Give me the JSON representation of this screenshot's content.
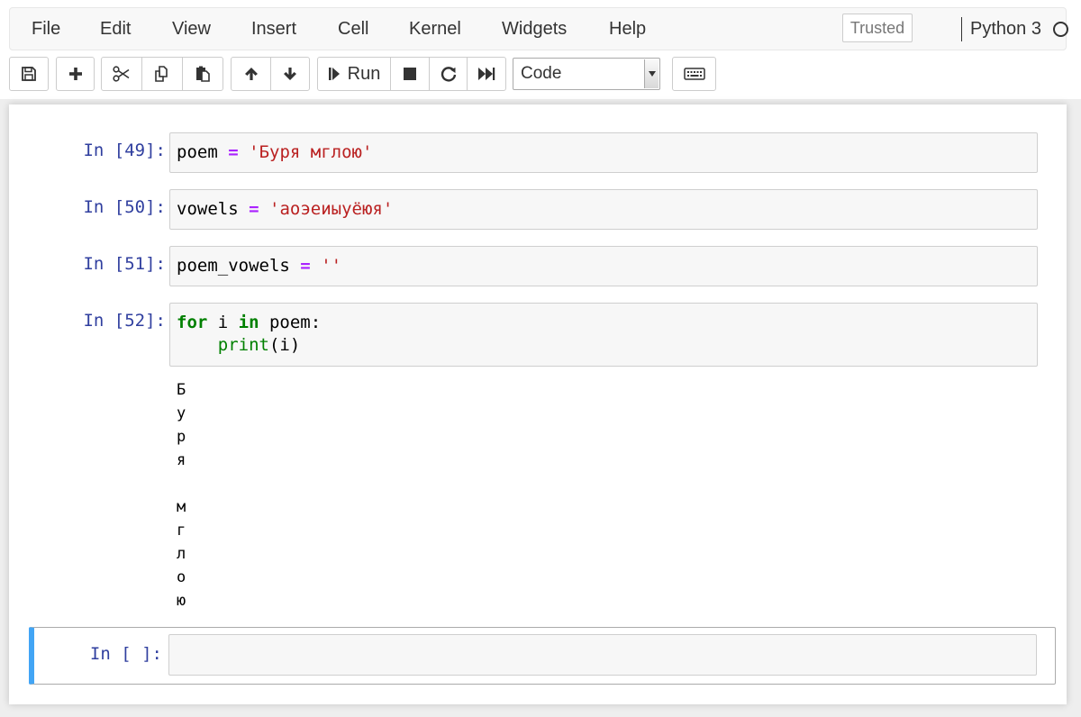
{
  "menubar": {
    "items": [
      "File",
      "Edit",
      "View",
      "Insert",
      "Cell",
      "Kernel",
      "Widgets",
      "Help"
    ],
    "trusted_label": "Trusted",
    "kernel_name": "Python 3"
  },
  "toolbar": {
    "run_label": "Run",
    "cell_type": "Code",
    "icons": [
      "save-icon",
      "plus-icon",
      "scissors-icon",
      "copy-icon",
      "paste-icon",
      "arrow-up-icon",
      "arrow-down-icon",
      "step-forward-icon",
      "stop-icon",
      "restart-icon",
      "fast-forward-icon",
      "keyboard-icon"
    ]
  },
  "cells": [
    {
      "prompt": "In [49]:",
      "tokens": [
        [
          "var",
          "poem"
        ],
        [
          "text",
          " "
        ],
        [
          "op",
          "="
        ],
        [
          "text",
          " "
        ],
        [
          "str",
          "'Буря мглою'"
        ]
      ]
    },
    {
      "prompt": "In [50]:",
      "tokens": [
        [
          "var",
          "vowels"
        ],
        [
          "text",
          " "
        ],
        [
          "op",
          "="
        ],
        [
          "text",
          " "
        ],
        [
          "str",
          "'аоэеиыуёюя'"
        ]
      ]
    },
    {
      "prompt": "In [51]:",
      "tokens": [
        [
          "var",
          "poem_vowels"
        ],
        [
          "text",
          " "
        ],
        [
          "op",
          "="
        ],
        [
          "text",
          " "
        ],
        [
          "str",
          "''"
        ]
      ]
    },
    {
      "prompt": "In [52]:",
      "tokens": [
        [
          "kw",
          "for"
        ],
        [
          "text",
          " i "
        ],
        [
          "kw",
          "in"
        ],
        [
          "text",
          " poem:\n    "
        ],
        [
          "builtin",
          "print"
        ],
        [
          "text",
          "(i)"
        ]
      ]
    }
  ],
  "output_lines": [
    "Б",
    "у",
    "р",
    "я",
    " ",
    "м",
    "г",
    "л",
    "о",
    "ю"
  ],
  "empty_cell": {
    "prompt": "In [ ]:"
  },
  "colors": {
    "prompt": "#303f9f",
    "keyword": "#008000",
    "operator": "#aa22ff",
    "string": "#ba2121",
    "active_cell_bar": "#42a5f5"
  }
}
